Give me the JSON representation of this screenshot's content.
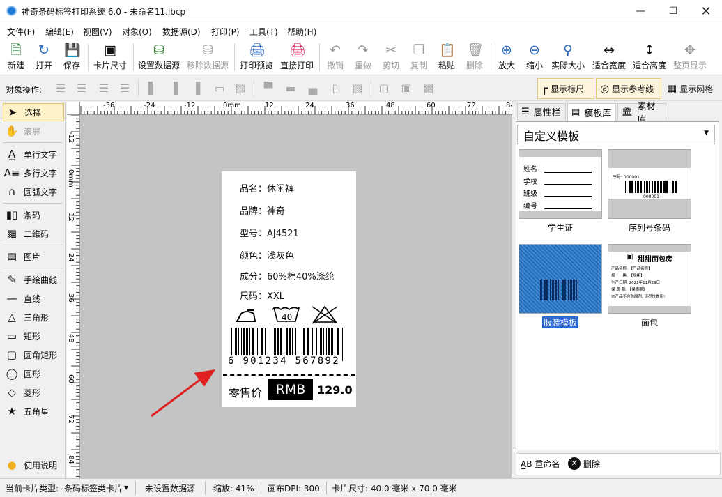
{
  "window": {
    "title": "神奇条码标签打印系统 6.0 - 未命名11.lbcp"
  },
  "menu": [
    "文件(F)",
    "编辑(E)",
    "视图(V)",
    "对象(O)",
    "数据源(D)",
    "打印(P)",
    "工具(T)",
    "帮助(H)"
  ],
  "toolbar": {
    "new": "新建",
    "open": "打开",
    "save": "保存",
    "card_size": "卡片尺寸",
    "set_datasource": "设置数据源",
    "remove_datasource": "移除数据源",
    "print_preview": "打印预览",
    "direct_print": "直接打印",
    "undo": "撤销",
    "redo": "重做",
    "cut": "剪切",
    "copy": "复制",
    "paste": "粘贴",
    "delete": "删除",
    "zoom_in": "放大",
    "zoom_out": "缩小",
    "actual_size": "实际大小",
    "fit_width": "适合宽度",
    "fit_height": "适合高度",
    "full_page": "整页显示"
  },
  "toolbar2": {
    "object_ops": "对象操作:",
    "show_ruler": "显示标尺",
    "show_guides": "显示参考线",
    "show_grid": "显示网格"
  },
  "tools": {
    "select": "选择",
    "scroll": "滚屏",
    "single_text": "单行文字",
    "multi_text": "多行文字",
    "arc_text": "圆弧文字",
    "barcode": "条码",
    "qrcode": "二维码",
    "image": "图片",
    "freehand": "手绘曲线",
    "line": "直线",
    "triangle": "三角形",
    "rect": "矩形",
    "roundrect": "圆角矩形",
    "circle": "圆形",
    "diamond": "菱形",
    "star": "五角星",
    "help": "使用说明"
  },
  "ruler": {
    "h_ticks": [
      "-36",
      "-24",
      "-12",
      "0mm",
      "12",
      "24",
      "36",
      "48",
      "60",
      "72",
      "84"
    ],
    "v_ticks": [
      "-12",
      "0mm",
      "12",
      "24",
      "36",
      "48",
      "60",
      "72",
      "84"
    ]
  },
  "label": {
    "lines": [
      "品名：休闲裤",
      "品牌：神奇",
      "型号：AJ4521",
      "颜色：浅灰色",
      "成分：60%棉40%涤纶",
      "尺码：XXL"
    ],
    "wash_temp": "40",
    "barcode_digits": "6 901234 567892",
    "price_label": "零售价",
    "currency": "RMB",
    "price": "129.0"
  },
  "right_panel": {
    "tabs": [
      "属性栏",
      "模板库",
      "素材库"
    ],
    "dropdown": "自定义模板",
    "templates": [
      {
        "name": "学生证",
        "fields": [
          "姓名",
          "学校",
          "班级",
          "编号"
        ]
      },
      {
        "name": "序列号条码",
        "serial_top": "序号: 000001",
        "serial_bottom": "000001"
      },
      {
        "name": "服装模板"
      },
      {
        "name": "面包",
        "heading": "甜甜面包房",
        "lines": [
          "产品名称: 【产品名称】",
          "规　　格: 【规格】",
          "生产日期: 2021年11月29日",
          "保 质 期: 【保质期】",
          "本产品不含防腐剂, 请尽快食用!"
        ]
      }
    ],
    "rename": "重命名",
    "delete": "删除"
  },
  "status": {
    "card_type_label": "当前卡片类型:",
    "card_type": "条码标签类卡片",
    "datasource": "未设置数据源",
    "zoom": "缩放: 41%",
    "dpi": "画布DPI: 300",
    "card_size": "卡片尺寸: 40.0 毫米 x 70.0 毫米"
  },
  "colors": {
    "accent": "#1f7ad6",
    "selected_bg": "#fdf2c8",
    "canvas": "#c4c4c4",
    "arrow": "#e02020"
  }
}
